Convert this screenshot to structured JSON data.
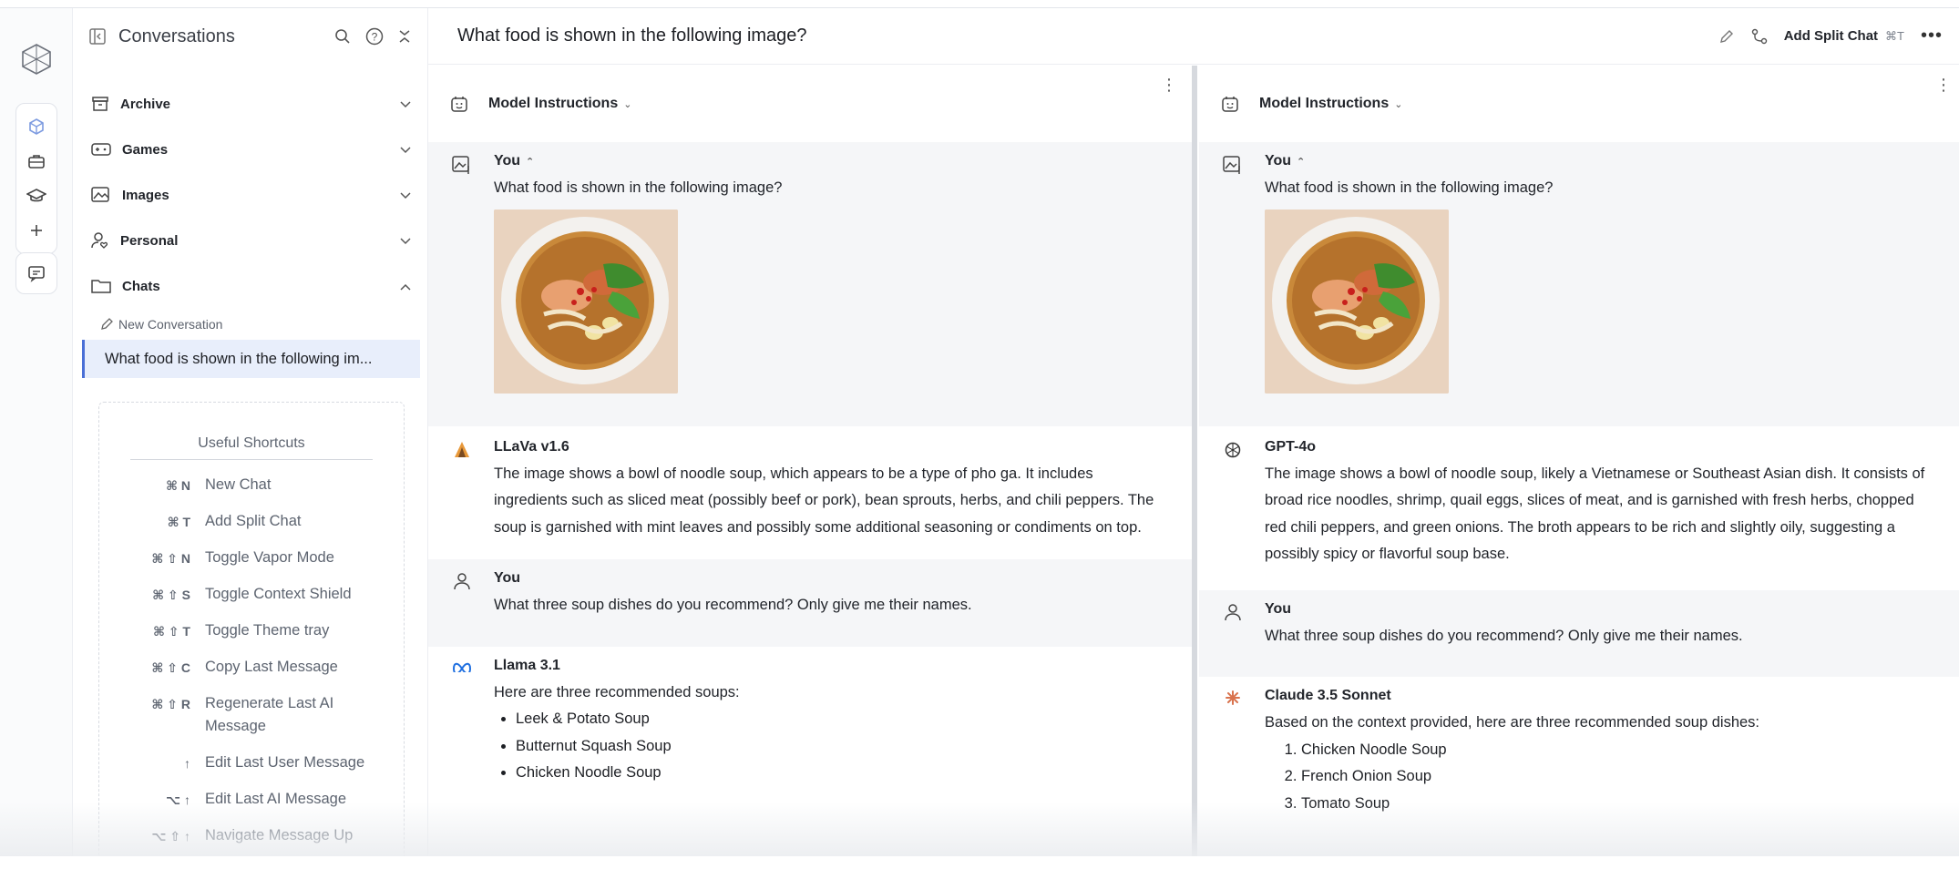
{
  "sidebar": {
    "title": "Conversations",
    "folders": [
      {
        "label": "Archive"
      },
      {
        "label": "Games"
      },
      {
        "label": "Images"
      },
      {
        "label": "Personal"
      },
      {
        "label": "Chats"
      }
    ],
    "new_conversation": "New Conversation",
    "active_chat": "What food is shown in the following im...",
    "shortcuts": {
      "title": "Useful Shortcuts",
      "items": [
        {
          "keys": "⌘ N",
          "label": "New Chat"
        },
        {
          "keys": "⌘ T",
          "label": "Add Split Chat"
        },
        {
          "keys": "⌘ ⇧ N",
          "label": "Toggle Vapor Mode"
        },
        {
          "keys": "⌘ ⇧ S",
          "label": "Toggle Context Shield"
        },
        {
          "keys": "⌘ ⇧ T",
          "label": "Toggle Theme tray"
        },
        {
          "keys": "⌘ ⇧ C",
          "label": "Copy Last Message"
        },
        {
          "keys": "⌘ ⇧ R",
          "label": "Regenerate Last AI Message"
        },
        {
          "keys": "↑",
          "label": "Edit Last User Message"
        },
        {
          "keys": "⌥ ↑",
          "label": "Edit Last AI Message"
        },
        {
          "keys": "⌥ ⇧ ↑",
          "label": "Navigate Message Up"
        }
      ]
    }
  },
  "topbar": {
    "title": "What food is shown in the following image?",
    "add_split_label": "Add Split Chat",
    "add_split_kbd": "⌘T"
  },
  "left_panel": {
    "model_instructions": "Model Instructions",
    "messages": [
      {
        "who": "You",
        "text": "What food is shown in the following image?"
      },
      {
        "who": "LLaVa v1.6",
        "text": "The image shows a bowl of noodle soup, which appears to be a type of pho ga. It includes ingredients such as sliced meat (possibly beef or pork), bean sprouts, herbs, and chili peppers. The soup is garnished with mint leaves and possibly some additional seasoning or condiments on top."
      },
      {
        "who": "You",
        "text": "What three soup dishes do you recommend? Only give me their names."
      },
      {
        "who": "Llama 3.1",
        "text": "Here are three recommended soups:",
        "items": [
          "Leek & Potato Soup",
          "Butternut Squash Soup",
          "Chicken Noodle Soup"
        ]
      }
    ]
  },
  "right_panel": {
    "model_instructions": "Model Instructions",
    "messages": [
      {
        "who": "You",
        "text": "What food is shown in the following image?"
      },
      {
        "who": "GPT-4o",
        "text": "The image shows a bowl of noodle soup, likely a Vietnamese or Southeast Asian dish. It consists of broad rice noodles, shrimp, quail eggs, slices of meat, and is garnished with fresh herbs, chopped red chili peppers, and green onions. The broth appears to be rich and slightly oily, suggesting a possibly spicy or flavorful soup base."
      },
      {
        "who": "You",
        "text": "What three soup dishes do you recommend? Only give me their names."
      },
      {
        "who": "Claude 3.5 Sonnet",
        "text": "Based on the context provided, here are three recommended soup dishes:",
        "items": [
          "Chicken Noodle Soup",
          "French Onion Soup",
          "Tomato Soup"
        ]
      }
    ]
  },
  "colors": {
    "accent": "#4a6fd6",
    "active_bg": "#e8eefb",
    "user_msg_bg": "#f5f6f8"
  }
}
